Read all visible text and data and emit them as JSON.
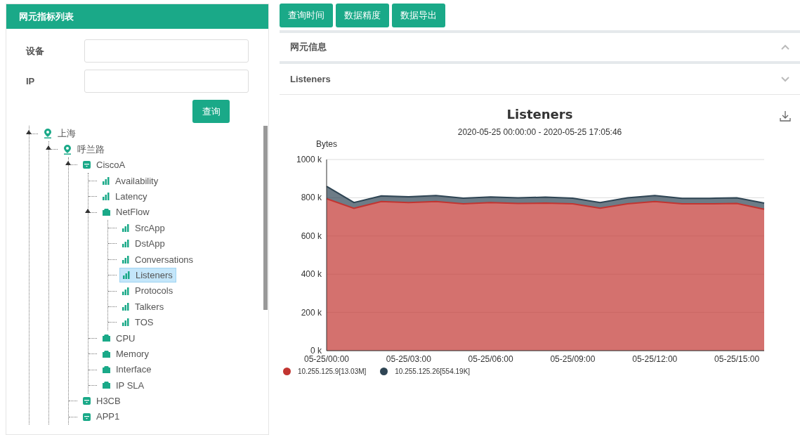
{
  "sidebar": {
    "title": "网元指标列表",
    "fields": [
      {
        "label": "设备"
      },
      {
        "label": "IP"
      }
    ],
    "search_button": "查询",
    "tree": [
      {
        "label": "上海",
        "kind": "location",
        "expanded": true,
        "selected": false,
        "children": [
          {
            "label": "呼兰路",
            "kind": "location",
            "expanded": true,
            "selected": false,
            "children": [
              {
                "label": "CiscoA",
                "kind": "device",
                "expanded": true,
                "selected": false,
                "children": [
                  {
                    "label": "Availability",
                    "kind": "metric",
                    "selected": false
                  },
                  {
                    "label": "Latency",
                    "kind": "metric",
                    "selected": false
                  },
                  {
                    "label": "NetFlow",
                    "kind": "group",
                    "expanded": true,
                    "selected": false,
                    "children": [
                      {
                        "label": "SrcApp",
                        "kind": "metric",
                        "selected": false
                      },
                      {
                        "label": "DstApp",
                        "kind": "metric",
                        "selected": false
                      },
                      {
                        "label": "Conversations",
                        "kind": "metric",
                        "selected": false
                      },
                      {
                        "label": "Listeners",
                        "kind": "metric",
                        "selected": true
                      },
                      {
                        "label": "Protocols",
                        "kind": "metric",
                        "selected": false
                      },
                      {
                        "label": "Talkers",
                        "kind": "metric",
                        "selected": false
                      },
                      {
                        "label": "TOS",
                        "kind": "metric",
                        "selected": false
                      }
                    ]
                  },
                  {
                    "label": "CPU",
                    "kind": "group",
                    "expanded": false,
                    "selected": false
                  },
                  {
                    "label": "Memory",
                    "kind": "group",
                    "expanded": false,
                    "selected": false
                  },
                  {
                    "label": "Interface",
                    "kind": "group",
                    "expanded": false,
                    "selected": false
                  },
                  {
                    "label": "IP SLA",
                    "kind": "group",
                    "expanded": false,
                    "selected": false
                  }
                ]
              },
              {
                "label": "H3CB",
                "kind": "device",
                "expanded": false,
                "selected": false
              },
              {
                "label": "APP1",
                "kind": "device",
                "expanded": false,
                "selected": false
              }
            ]
          }
        ]
      }
    ]
  },
  "toolbar": [
    "查询时间",
    "数据精度",
    "数据导出"
  ],
  "panels": [
    {
      "title": "网元信息",
      "expanded": true
    },
    {
      "title": "Listeners",
      "expanded": false
    }
  ],
  "chart": {
    "title": "Listeners",
    "subtitle": "2020-05-25 00:00:00 - 2020-05-25 17:05:46",
    "chart_data": {
      "type": "area",
      "stacked": true,
      "ylabel": "Bytes",
      "categories": [
        "05-25/00:00",
        null,
        null,
        "05-25/03:00",
        null,
        null,
        "05-25/06:00",
        null,
        null,
        "05-25/09:00",
        null,
        null,
        "05-25/12:00",
        null,
        null,
        "05-25/15:00",
        null
      ],
      "grid": true,
      "ylim": [
        0,
        1000000
      ],
      "yticks": [
        {
          "value": 0,
          "label": "0 k"
        },
        {
          "value": 200000,
          "label": "200 k"
        },
        {
          "value": 400000,
          "label": "400 k"
        },
        {
          "value": 600000,
          "label": "600 k"
        },
        {
          "value": 800000,
          "label": "800 k"
        },
        {
          "value": 1000000,
          "label": "1000 k"
        }
      ],
      "series": [
        {
          "name": "10.255.125.9[13.03M]",
          "color": "#c23531",
          "values": [
            795000,
            745000,
            780000,
            775000,
            780000,
            768000,
            775000,
            770000,
            772000,
            768000,
            745000,
            768000,
            780000,
            768000,
            768000,
            770000,
            740000
          ]
        },
        {
          "name": "10.255.125.26[554.19K]",
          "color": "#2f4554",
          "values": [
            65000,
            30000,
            30000,
            30000,
            32000,
            30000,
            29000,
            30000,
            31000,
            30000,
            30000,
            32000,
            32000,
            29000,
            29000,
            30000,
            32000
          ]
        }
      ]
    }
  }
}
